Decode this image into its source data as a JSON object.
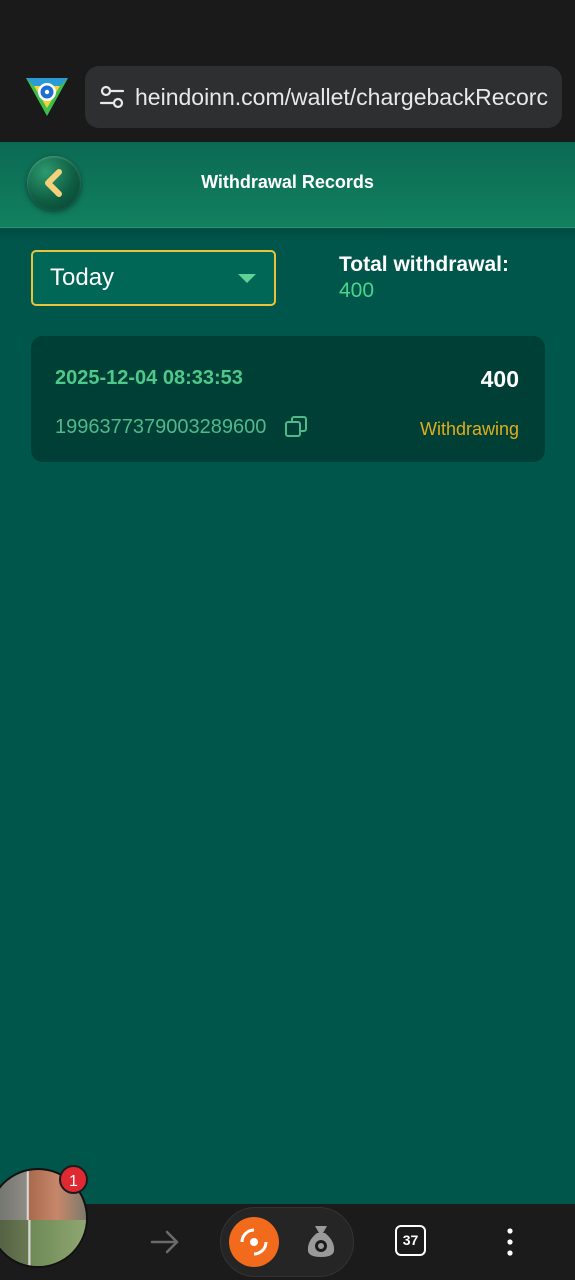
{
  "browser": {
    "url": "heindoinn.com/wallet/chargebackRecorc",
    "tab_count": "37"
  },
  "header": {
    "title": "Withdrawal Records"
  },
  "filter": {
    "selected_period": "Today",
    "total_label": "Total withdrawal:",
    "total_value": "400"
  },
  "records": [
    {
      "time": "2025-12-04 08:33:53",
      "amount": "400",
      "id": "1996377379003289600",
      "status": "Withdrawing"
    }
  ],
  "notifications": {
    "badge_count": "1"
  },
  "colors": {
    "background": "#00564a",
    "accent_green": "#49d68a",
    "select_border": "#e9c33c",
    "status_pending": "#e1ad1c",
    "card_bg": "#003f35"
  }
}
